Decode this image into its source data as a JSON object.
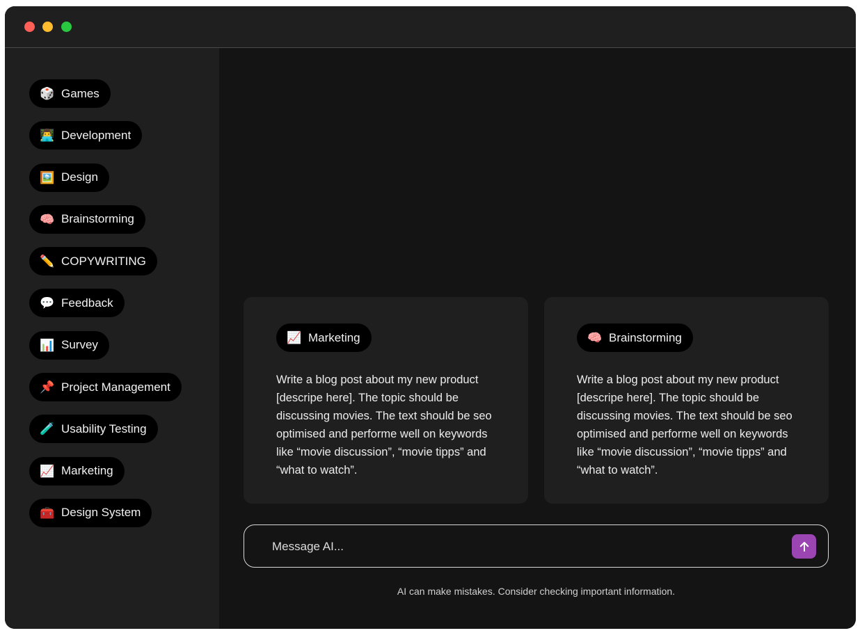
{
  "window": {
    "controls": [
      "close",
      "minimize",
      "maximize"
    ]
  },
  "sidebar": {
    "items": [
      {
        "icon": "🎲",
        "icon_name": "dice-icon",
        "label": "Games"
      },
      {
        "icon": "👨‍💻",
        "icon_name": "developer-icon",
        "label": "Development"
      },
      {
        "icon": "🖼️",
        "icon_name": "picture-icon",
        "label": "Design"
      },
      {
        "icon": "🧠",
        "icon_name": "brain-icon",
        "label": "Brainstorming"
      },
      {
        "icon": "✏️",
        "icon_name": "pencil-icon",
        "label": "COPYWRITING"
      },
      {
        "icon": "💬",
        "icon_name": "speech-bubble-icon",
        "label": "Feedback"
      },
      {
        "icon": "📊",
        "icon_name": "bar-chart-icon",
        "label": "Survey"
      },
      {
        "icon": "📌",
        "icon_name": "pushpin-icon",
        "label": "Project Management"
      },
      {
        "icon": "🧪",
        "icon_name": "test-tube-icon",
        "label": "Usability Testing"
      },
      {
        "icon": "📈",
        "icon_name": "chart-increasing-icon",
        "label": "Marketing"
      },
      {
        "icon": "🧰",
        "icon_name": "toolbox-icon",
        "label": "Design System"
      }
    ]
  },
  "cards": [
    {
      "tag_icon": "📈",
      "tag_icon_name": "chart-increasing-icon",
      "tag_label": "Marketing",
      "text": "Write a blog post about my new product [descripe here]. The topic should be discussing movies. The text should be seo optimised and performe well on keywords like “movie discussion”, “movie tipps” and “what to watch”."
    },
    {
      "tag_icon": "🧠",
      "tag_icon_name": "brain-icon",
      "tag_label": "Brainstorming",
      "text": "Write a blog post about my new product [descripe here]. The topic should be discussing movies. The text should be seo optimised and performe well on keywords like “movie discussion”, “movie tipps” and “what to watch”."
    }
  ],
  "composer": {
    "placeholder": "Message AI...",
    "value": "",
    "send_icon": "arrow-up-icon",
    "send_color": "#9b45b3"
  },
  "footer": {
    "disclaimer": "AI can make mistakes. Consider checking important information."
  },
  "colors": {
    "window_bg": "#1f1f1f",
    "main_bg": "#141414",
    "pill_bg": "#000000",
    "accent": "#9b45b3"
  }
}
